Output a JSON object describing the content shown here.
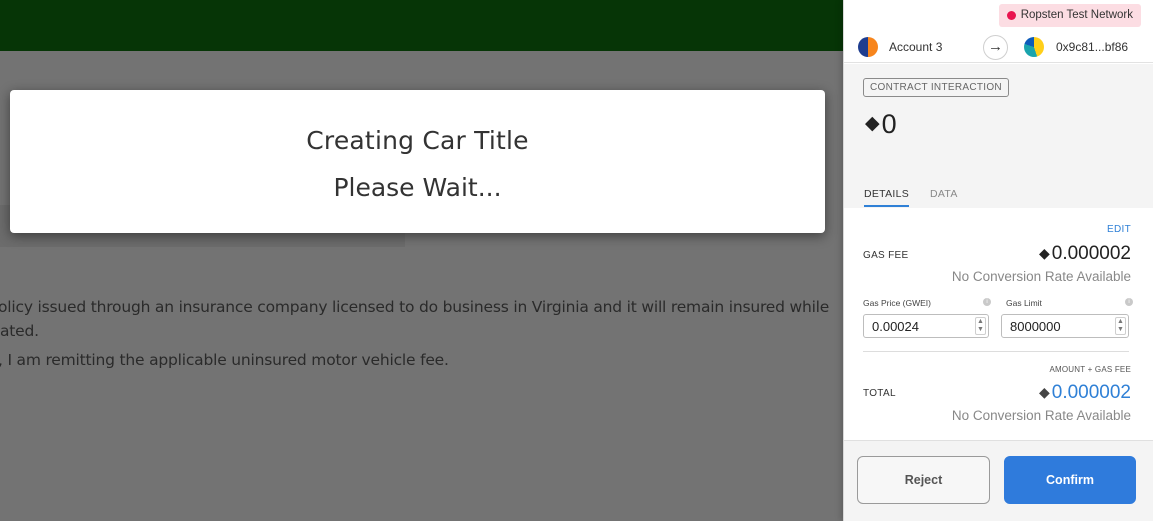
{
  "page": {
    "line1": "olicy issued through an insurance company licensed to do business in Virginia and it will remain insured while",
    "line2": "ated.",
    "line3": ", I am remitting the applicable uninsured motor vehicle fee."
  },
  "modal": {
    "title": "Creating Car Title",
    "subtitle": "Please Wait..."
  },
  "wallet": {
    "network": "Ropsten Test Network",
    "from_account": "Account 3",
    "to_address": "0x9c81...bf86",
    "tag": "CONTRACT INTERACTION",
    "amount": "0",
    "tabs": {
      "details": "DETAILS",
      "data": "DATA"
    },
    "edit": "EDIT",
    "gas_fee_label": "GAS FEE",
    "gas_fee_value": "0.000002",
    "gas_fee_conversion": "No Conversion Rate Available",
    "gas_price_label": "Gas Price (GWEI)",
    "gas_limit_label": "Gas Limit",
    "gas_price_value": "0.00024",
    "gas_limit_value": "8000000",
    "total_caption": "AMOUNT + GAS FEE",
    "total_label": "TOTAL",
    "total_value": "0.000002",
    "total_conversion": "No Conversion Rate Available",
    "reject_label": "Reject",
    "confirm_label": "Confirm",
    "colors": {
      "accent": "#2f7bdc",
      "network_dot": "#e91550",
      "header_green": "#0c6b0c"
    },
    "icons": {
      "eth": "ethereum-icon",
      "arrow": "arrow-right-icon",
      "info": "info-icon"
    }
  }
}
